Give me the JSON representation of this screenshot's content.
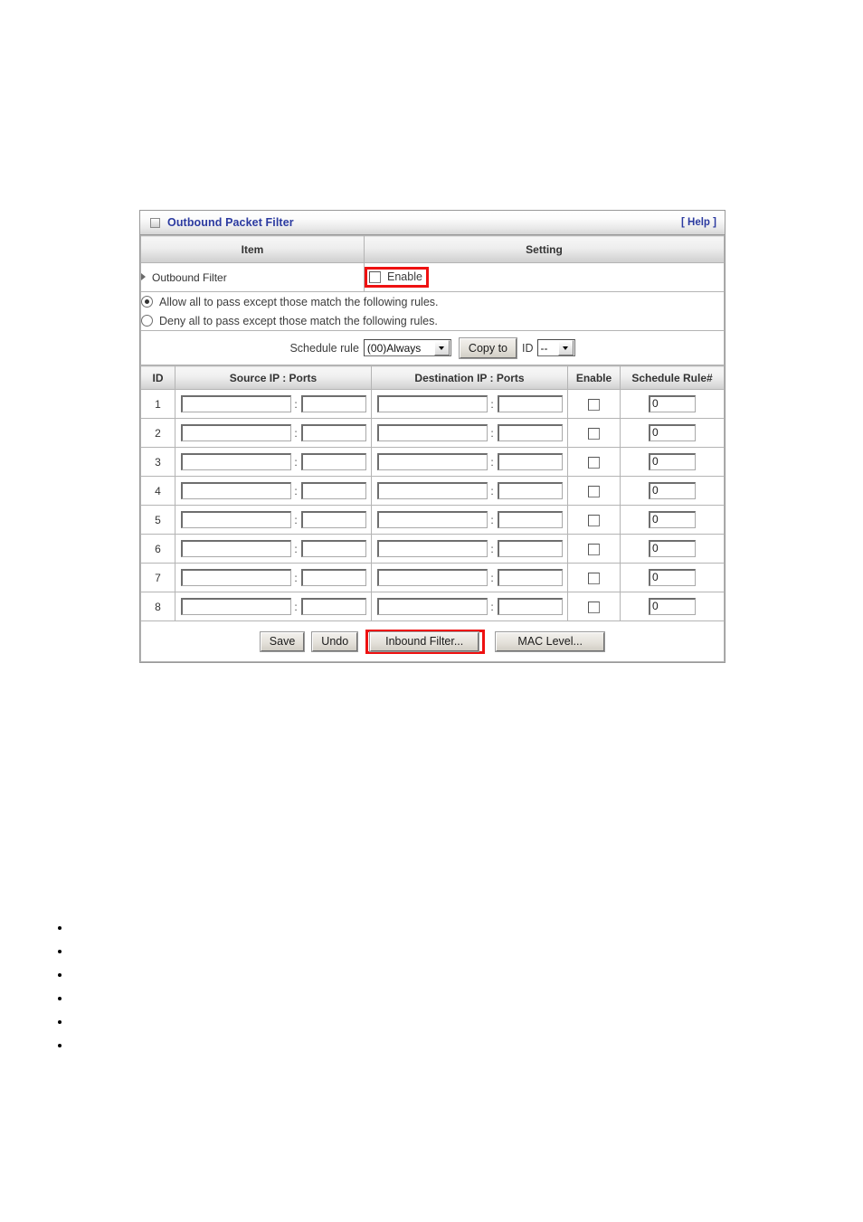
{
  "panel": {
    "title": "Outbound Packet Filter",
    "title_icon": "window-box-icon",
    "help_label": "[ Help ]",
    "accent_color": "#2b3aa0",
    "highlight_color": "#ee1111"
  },
  "table_headers": {
    "item": "Item",
    "setting": "Setting"
  },
  "outbound_filter": {
    "label": "Outbound Filter",
    "enable_label": "Enable",
    "enable_checked": false,
    "highlighted": true
  },
  "policy": {
    "options": [
      {
        "label": "Allow all to pass except those match the following rules.",
        "selected": true
      },
      {
        "label": "Deny all to pass except those match the following rules.",
        "selected": false
      }
    ]
  },
  "schedule_bar": {
    "label": "Schedule rule",
    "rule_value": "(00)Always",
    "copy_to_label": "Copy to",
    "id_label": "ID",
    "id_value": "--"
  },
  "rules_table": {
    "columns": [
      "ID",
      "Source IP : Ports",
      "Destination IP : Ports",
      "Enable",
      "Schedule Rule#"
    ],
    "separator": ":",
    "rows": [
      {
        "id": "1",
        "source_ip": "",
        "source_port": "",
        "dest_ip": "",
        "dest_port": "",
        "enable": false,
        "schedule_rule": "0"
      },
      {
        "id": "2",
        "source_ip": "",
        "source_port": "",
        "dest_ip": "",
        "dest_port": "",
        "enable": false,
        "schedule_rule": "0"
      },
      {
        "id": "3",
        "source_ip": "",
        "source_port": "",
        "dest_ip": "",
        "dest_port": "",
        "enable": false,
        "schedule_rule": "0"
      },
      {
        "id": "4",
        "source_ip": "",
        "source_port": "",
        "dest_ip": "",
        "dest_port": "",
        "enable": false,
        "schedule_rule": "0"
      },
      {
        "id": "5",
        "source_ip": "",
        "source_port": "",
        "dest_ip": "",
        "dest_port": "",
        "enable": false,
        "schedule_rule": "0"
      },
      {
        "id": "6",
        "source_ip": "",
        "source_port": "",
        "dest_ip": "",
        "dest_port": "",
        "enable": false,
        "schedule_rule": "0"
      },
      {
        "id": "7",
        "source_ip": "",
        "source_port": "",
        "dest_ip": "",
        "dest_port": "",
        "enable": false,
        "schedule_rule": "0"
      },
      {
        "id": "8",
        "source_ip": "",
        "source_port": "",
        "dest_ip": "",
        "dest_port": "",
        "enable": false,
        "schedule_rule": "0"
      }
    ]
  },
  "footer": {
    "save_label": "Save",
    "undo_label": "Undo",
    "inbound_filter_label": "Inbound Filter...",
    "inbound_filter_highlighted": true,
    "mac_level_label": "MAC Level..."
  },
  "bullets": [
    "",
    "",
    "",
    "",
    "",
    ""
  ]
}
